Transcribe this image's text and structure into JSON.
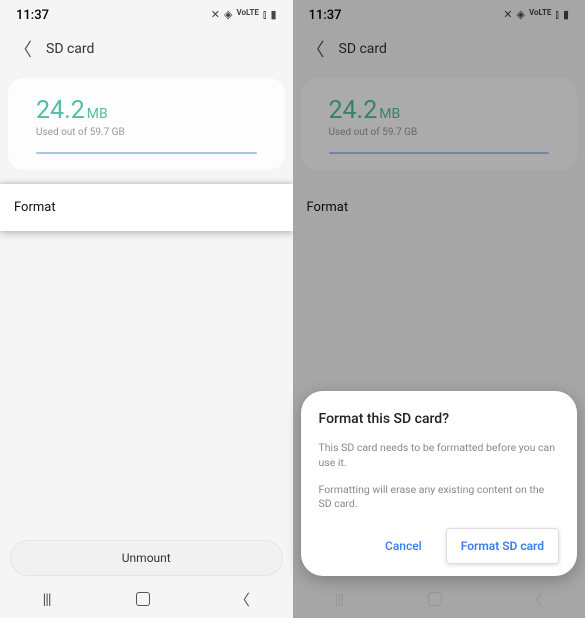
{
  "left": {
    "status": {
      "time": "11:37"
    },
    "header": {
      "title": "SD card"
    },
    "storage": {
      "value": "24.2",
      "unit": "MB",
      "subtitle": "Used out of 59.7 GB"
    },
    "format_label": "Format",
    "unmount_label": "Unmount"
  },
  "right": {
    "status": {
      "time": "11:37"
    },
    "header": {
      "title": "SD card"
    },
    "storage": {
      "value": "24.2",
      "unit": "MB",
      "subtitle": "Used out of 59.7 GB"
    },
    "format_label": "Format",
    "dialog": {
      "title": "Format this SD card?",
      "line1": "This SD card needs to be formatted before you can use it.",
      "line2": "Formatting will erase any existing content on the SD card.",
      "cancel": "Cancel",
      "confirm": "Format SD card"
    }
  }
}
